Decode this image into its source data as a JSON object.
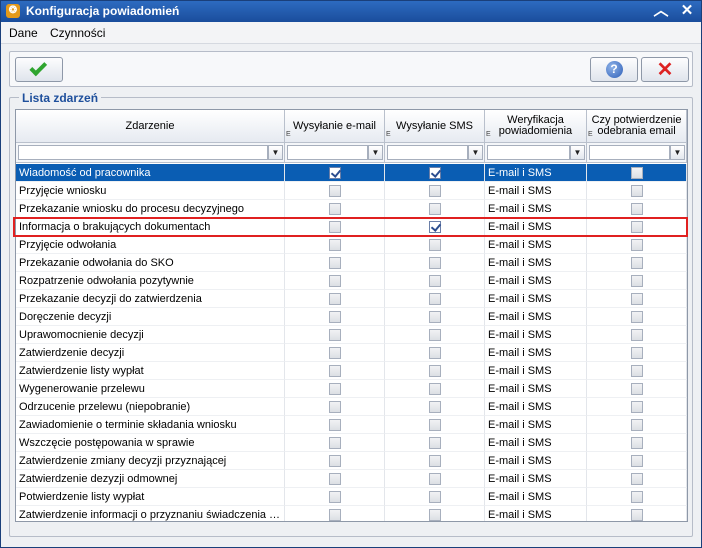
{
  "window": {
    "title": "Konfiguracja powiadomień",
    "app_icon": "app-icon"
  },
  "menu": [
    {
      "label": "Dane"
    },
    {
      "label": "Czynności"
    }
  ],
  "toolbar": {
    "ok_icon": "checkmark-icon",
    "help_icon": "help-icon",
    "cancel_icon": "cancel-x-icon"
  },
  "group": {
    "label": "Lista zdarzeń"
  },
  "columns": [
    {
      "label": "Zdarzenie"
    },
    {
      "label": "Wysyłanie e-mail"
    },
    {
      "label": "Wysyłanie SMS"
    },
    {
      "label": "Weryfikacja powiadomienia"
    },
    {
      "label": "Czy potwierdzenie odebrania email"
    }
  ],
  "rows": [
    {
      "event": "Wiadomość od pracownika",
      "email": true,
      "sms": true,
      "verification": "E-mail i SMS",
      "confirm": false,
      "selected": true
    },
    {
      "event": "Przyjęcie wniosku",
      "email": false,
      "sms": false,
      "verification": "E-mail i SMS",
      "confirm": false
    },
    {
      "event": "Przekazanie wniosku do procesu decyzyjnego",
      "email": false,
      "sms": false,
      "verification": "E-mail i SMS",
      "confirm": false
    },
    {
      "event": "Informacja o brakujących dokumentach",
      "email": false,
      "sms": true,
      "verification": "E-mail i SMS",
      "confirm": false,
      "highlighted": true
    },
    {
      "event": "Przyjęcie odwołania",
      "email": false,
      "sms": false,
      "verification": "E-mail i SMS",
      "confirm": false
    },
    {
      "event": "Przekazanie odwołania do SKO",
      "email": false,
      "sms": false,
      "verification": "E-mail i SMS",
      "confirm": false
    },
    {
      "event": "Rozpatrzenie odwołania pozytywnie",
      "email": false,
      "sms": false,
      "verification": "E-mail i SMS",
      "confirm": false
    },
    {
      "event": "Przekazanie decyzji do zatwierdzenia",
      "email": false,
      "sms": false,
      "verification": "E-mail i SMS",
      "confirm": false
    },
    {
      "event": "Doręczenie decyzji",
      "email": false,
      "sms": false,
      "verification": "E-mail i SMS",
      "confirm": false
    },
    {
      "event": "Uprawomocnienie decyzji",
      "email": false,
      "sms": false,
      "verification": "E-mail i SMS",
      "confirm": false
    },
    {
      "event": "Zatwierdzenie decyzji",
      "email": false,
      "sms": false,
      "verification": "E-mail i SMS",
      "confirm": false
    },
    {
      "event": "Zatwierdzenie listy wypłat",
      "email": false,
      "sms": false,
      "verification": "E-mail i SMS",
      "confirm": false
    },
    {
      "event": "Wygenerowanie przelewu",
      "email": false,
      "sms": false,
      "verification": "E-mail i SMS",
      "confirm": false
    },
    {
      "event": "Odrzucenie przelewu (niepobranie)",
      "email": false,
      "sms": false,
      "verification": "E-mail i SMS",
      "confirm": false
    },
    {
      "event": "Zawiadomienie o terminie składania wniosku",
      "email": false,
      "sms": false,
      "verification": "E-mail i SMS",
      "confirm": false
    },
    {
      "event": "Wszczęcie postępowania w sprawie",
      "email": false,
      "sms": false,
      "verification": "E-mail i SMS",
      "confirm": false
    },
    {
      "event": "Zatwierdzenie zmiany decyzji przyznającej",
      "email": false,
      "sms": false,
      "verification": "E-mail i SMS",
      "confirm": false
    },
    {
      "event": "Zatwierdzenie dezyzji odmownej",
      "email": false,
      "sms": false,
      "verification": "E-mail i SMS",
      "confirm": false
    },
    {
      "event": "Potwierdzenie listy wypłat",
      "email": false,
      "sms": false,
      "verification": "E-mail i SMS",
      "confirm": false
    },
    {
      "event": "Zatwierdzenie informacji o przyznaniu świadczenia …",
      "email": false,
      "sms": false,
      "verification": "E-mail i SMS",
      "confirm": false
    }
  ],
  "colors": {
    "selection": "#0a5db3",
    "highlight_border": "#e02020",
    "title_bar": "#1a4d9c"
  }
}
